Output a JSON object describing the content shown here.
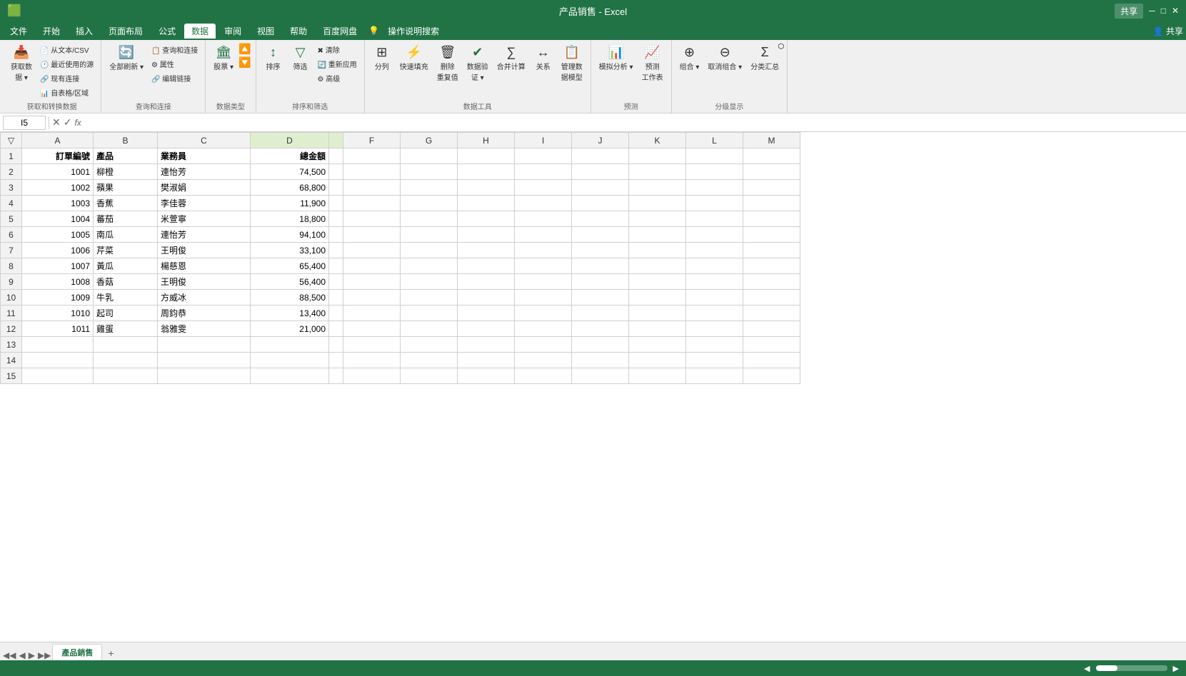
{
  "titleBar": {
    "title": "产品销售 - Excel",
    "shareLabel": "共享"
  },
  "menuBar": {
    "items": [
      "文件",
      "开始",
      "插入",
      "页面布局",
      "公式",
      "数据",
      "审阅",
      "视图",
      "帮助",
      "百度网盘",
      "操作说明搜索"
    ]
  },
  "ribbon": {
    "groups": [
      {
        "label": "获取和转换数据",
        "buttons": [
          {
            "label": "获取数\n据",
            "icon": "📥"
          },
          {
            "smallButtons": [
              "从文本/CSV",
              "最近使用的源",
              "现有连接",
              "自表格/区域"
            ]
          }
        ]
      },
      {
        "label": "查询和连接",
        "buttons": [
          {
            "label": "全部刷新",
            "icon": "🔄"
          },
          {
            "smallButtons": [
              "查询和连接",
              "属性",
              "编辑链接"
            ]
          }
        ]
      },
      {
        "label": "数据类型",
        "buttons": [
          {
            "label": "股票",
            "icon": "🏛",
            "hasDropdown": true
          }
        ]
      },
      {
        "label": "排序和筛选",
        "buttons": [
          {
            "label": "排序",
            "icon": "↕"
          },
          {
            "label": "筛选",
            "icon": "🔽"
          },
          {
            "smallButtons": [
              "清除",
              "重新应用",
              "高级"
            ]
          }
        ]
      },
      {
        "label": "数据工具",
        "buttons": [
          {
            "label": "分列",
            "icon": "⊞"
          },
          {
            "label": "快速填充",
            "icon": "⚡"
          },
          {
            "label": "删除\n重复值",
            "icon": "🗑"
          },
          {
            "label": "数据验\n证",
            "icon": "✔"
          },
          {
            "label": "合并计算",
            "icon": "∑"
          },
          {
            "label": "关系",
            "icon": "↔"
          },
          {
            "label": "管理数\n据模型",
            "icon": "📋"
          }
        ]
      },
      {
        "label": "预测",
        "buttons": [
          {
            "label": "模拟分析",
            "icon": "📊"
          },
          {
            "label": "预测\n工作表",
            "icon": "📈"
          }
        ]
      },
      {
        "label": "分级显示",
        "buttons": [
          {
            "label": "组合",
            "icon": "⊕"
          },
          {
            "label": "取消组合",
            "icon": "⊖"
          },
          {
            "label": "分类汇总",
            "icon": "Σ"
          }
        ]
      }
    ]
  },
  "formulaBar": {
    "cellRef": "I5",
    "formula": ""
  },
  "columns": [
    "A",
    "B",
    "C",
    "D",
    "F",
    "G",
    "H",
    "I",
    "J",
    "K",
    "L",
    "M"
  ],
  "columnWidths": {
    "A": 80,
    "B": 80,
    "C": 120,
    "D": 100,
    "default": 60
  },
  "headers": {
    "row1": [
      "訂單編號",
      "產品",
      "業務員",
      "總金額",
      "",
      "",
      "",
      "",
      "",
      "",
      "",
      ""
    ]
  },
  "rows": [
    {
      "num": 2,
      "A": "1001",
      "B": "柳橙",
      "C": "連怡芳",
      "D": "74,500"
    },
    {
      "num": 3,
      "A": "1002",
      "B": "蘋果",
      "C": "樊淑娟",
      "D": "68,800"
    },
    {
      "num": 4,
      "A": "1003",
      "B": "香蕉",
      "C": "李佳蓉",
      "D": "11,900"
    },
    {
      "num": 5,
      "A": "1004",
      "B": "蕃茄",
      "C": "米萱寧",
      "D": "18,800"
    },
    {
      "num": 6,
      "A": "1005",
      "B": "南瓜",
      "C": "連怡芳",
      "D": "94,100"
    },
    {
      "num": 7,
      "A": "1006",
      "B": "芹菜",
      "C": "王明俊",
      "D": "33,100"
    },
    {
      "num": 8,
      "A": "1007",
      "B": "黃瓜",
      "C": "楊慈恩",
      "D": "65,400"
    },
    {
      "num": 9,
      "A": "1008",
      "B": "香菇",
      "C": "王明俊",
      "D": "56,400"
    },
    {
      "num": 10,
      "A": "1009",
      "B": "牛乳",
      "C": "方威冰",
      "D": "88,500"
    },
    {
      "num": 11,
      "A": "1010",
      "B": "起司",
      "C": "周鈞恭",
      "D": "13,400"
    },
    {
      "num": 12,
      "A": "1011",
      "B": "雞蛋",
      "C": "翁雅雯",
      "D": "21,000"
    },
    {
      "num": 13,
      "A": "",
      "B": "",
      "C": "",
      "D": ""
    },
    {
      "num": 14,
      "A": "",
      "B": "",
      "C": "",
      "D": ""
    },
    {
      "num": 15,
      "A": "",
      "B": "",
      "C": "",
      "D": ""
    }
  ],
  "sheetTabs": {
    "tabs": [
      "產品銷售"
    ],
    "active": "產品銷售"
  },
  "statusBar": {
    "left": "",
    "scrollLeft": "◀",
    "scrollRight": "▶"
  }
}
